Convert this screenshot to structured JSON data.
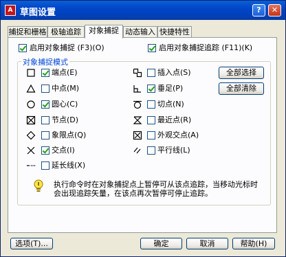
{
  "window": {
    "title": "草图设置",
    "help_glyph": "?",
    "close_glyph": "✕"
  },
  "tabs": [
    {
      "label": "捕捉和栅格",
      "active": false
    },
    {
      "label": "极轴追踪",
      "active": false
    },
    {
      "label": "对象捕捉",
      "active": true
    },
    {
      "label": "动态输入",
      "active": false
    },
    {
      "label": "快捷特性",
      "active": false
    }
  ],
  "top_options": {
    "enable_osnap": {
      "label": "启用对象捕捉 (F3)(O)",
      "checked": true
    },
    "enable_tracking": {
      "label": "启用对象捕捉追踪 (F11)(K)",
      "checked": true
    }
  },
  "group": {
    "title": "对象捕捉模式",
    "left": [
      {
        "label": "端点(E)",
        "checked": true,
        "icon": "square-icon"
      },
      {
        "label": "中点(M)",
        "checked": false,
        "icon": "triangle-icon"
      },
      {
        "label": "圆心(C)",
        "checked": true,
        "icon": "circle-icon"
      },
      {
        "label": "节点(D)",
        "checked": false,
        "icon": "node-icon"
      },
      {
        "label": "象限点(Q)",
        "checked": false,
        "icon": "diamond-icon"
      },
      {
        "label": "交点(I)",
        "checked": true,
        "icon": "x-icon"
      },
      {
        "label": "延长线(X)",
        "checked": false,
        "icon": "extension-icon"
      }
    ],
    "right": [
      {
        "label": "插入点(S)",
        "checked": false,
        "icon": "insertion-icon"
      },
      {
        "label": "垂足(P)",
        "checked": true,
        "icon": "perpendicular-icon"
      },
      {
        "label": "切点(N)",
        "checked": false,
        "icon": "tangent-icon"
      },
      {
        "label": "最近点(R)",
        "checked": false,
        "icon": "nearest-icon"
      },
      {
        "label": "外观交点(A)",
        "checked": false,
        "icon": "apparent-intersection-icon"
      },
      {
        "label": "平行线(L)",
        "checked": false,
        "icon": "parallel-icon"
      }
    ],
    "select_all": "全部选择",
    "clear_all": "全部清除",
    "note_line1": "执行命令时在对象捕捉点上暂停可从该点追踪，当移动光标时",
    "note_line2": "会出现追踪矢量，在该点再次暂停可停止追踪。"
  },
  "buttons": {
    "options": "选项(T)...",
    "ok": "确定",
    "cancel": "取消",
    "help": "帮助(H)"
  }
}
